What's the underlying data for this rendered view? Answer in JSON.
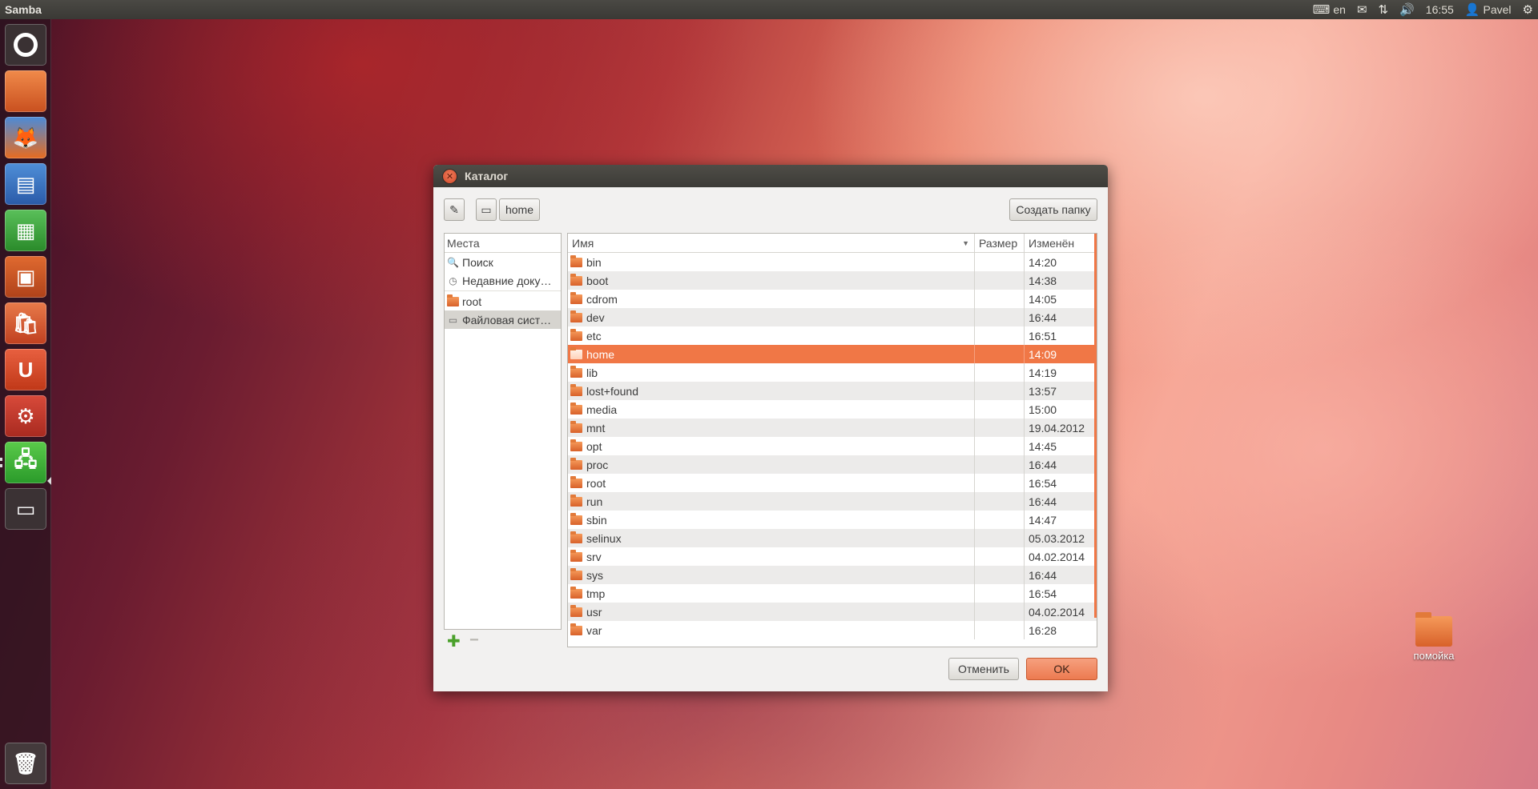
{
  "top_panel": {
    "app_title": "Samba",
    "keyboard_layout": "en",
    "clock": "16:55",
    "user": "Pavel",
    "icons": [
      "keyboard-icon",
      "mail-icon",
      "network-icon",
      "volume-icon",
      "user-icon",
      "gear-icon"
    ]
  },
  "launcher": {
    "items": [
      "dash",
      "files",
      "firefox",
      "libreoffice-writer",
      "libreoffice-calc",
      "libreoffice-impress",
      "software-center",
      "ubuntu-one",
      "system-settings",
      "samba",
      "workspace-switcher",
      "trash"
    ],
    "ubuntu_one_letter": "U"
  },
  "desktop": {
    "icon_label": "помойка"
  },
  "dialog": {
    "title": "Каталог",
    "path_buttons": [
      "home"
    ],
    "create_folder_label": "Создать папку",
    "cancel_label": "Отменить",
    "ok_label": "OK",
    "places": {
      "header": "Места",
      "items": [
        {
          "label": "Поиск",
          "icon": "search-icon"
        },
        {
          "label": "Недавние доку…",
          "icon": "recent-icon"
        },
        {
          "label": "root",
          "icon": "home-folder-icon"
        },
        {
          "label": "Файловая сист…",
          "icon": "drive-icon"
        }
      ]
    },
    "files": {
      "headers": {
        "name": "Имя",
        "size": "Размер",
        "modified": "Изменён"
      },
      "rows": [
        {
          "name": "bin",
          "modified": "14:20"
        },
        {
          "name": "boot",
          "modified": "14:38"
        },
        {
          "name": "cdrom",
          "modified": "14:05"
        },
        {
          "name": "dev",
          "modified": "16:44"
        },
        {
          "name": "etc",
          "modified": "16:51"
        },
        {
          "name": "home",
          "modified": "14:09"
        },
        {
          "name": "lib",
          "modified": "14:19"
        },
        {
          "name": "lost+found",
          "modified": "13:57"
        },
        {
          "name": "media",
          "modified": "15:00"
        },
        {
          "name": "mnt",
          "modified": "19.04.2012"
        },
        {
          "name": "opt",
          "modified": "14:45"
        },
        {
          "name": "proc",
          "modified": "16:44"
        },
        {
          "name": "root",
          "modified": "16:54"
        },
        {
          "name": "run",
          "modified": "16:44"
        },
        {
          "name": "sbin",
          "modified": "14:47"
        },
        {
          "name": "selinux",
          "modified": "05.03.2012"
        },
        {
          "name": "srv",
          "modified": "04.02.2014"
        },
        {
          "name": "sys",
          "modified": "16:44"
        },
        {
          "name": "tmp",
          "modified": "16:54"
        },
        {
          "name": "usr",
          "modified": "04.02.2014"
        },
        {
          "name": "var",
          "modified": "16:28"
        }
      ],
      "selected_name": "home"
    }
  },
  "colors": {
    "accent": "#f07746",
    "panel": "#3c3b37",
    "dialog_bg": "#f2f1f0"
  }
}
